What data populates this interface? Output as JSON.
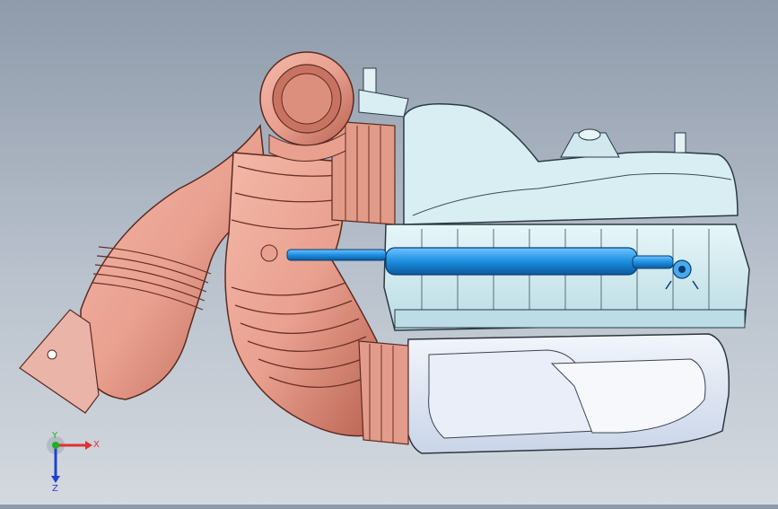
{
  "viewport": {
    "background_top": "#8f9bab",
    "background_bottom": "#d4d9df"
  },
  "model": {
    "colors": {
      "intake_hose": "#e9a08f",
      "intake_hose_shadow": "#b8604f",
      "airbox": "#cfe8ee",
      "airbox_edge": "#3a4a55",
      "lower_tray": "#dde6f2",
      "actuator_rod": "#1e8fe0"
    }
  },
  "triad": {
    "x_label": "X",
    "y_label": "Y",
    "z_label": "Z",
    "x_color": "#e03030",
    "y_color": "#20b020",
    "z_color": "#2040d0"
  }
}
